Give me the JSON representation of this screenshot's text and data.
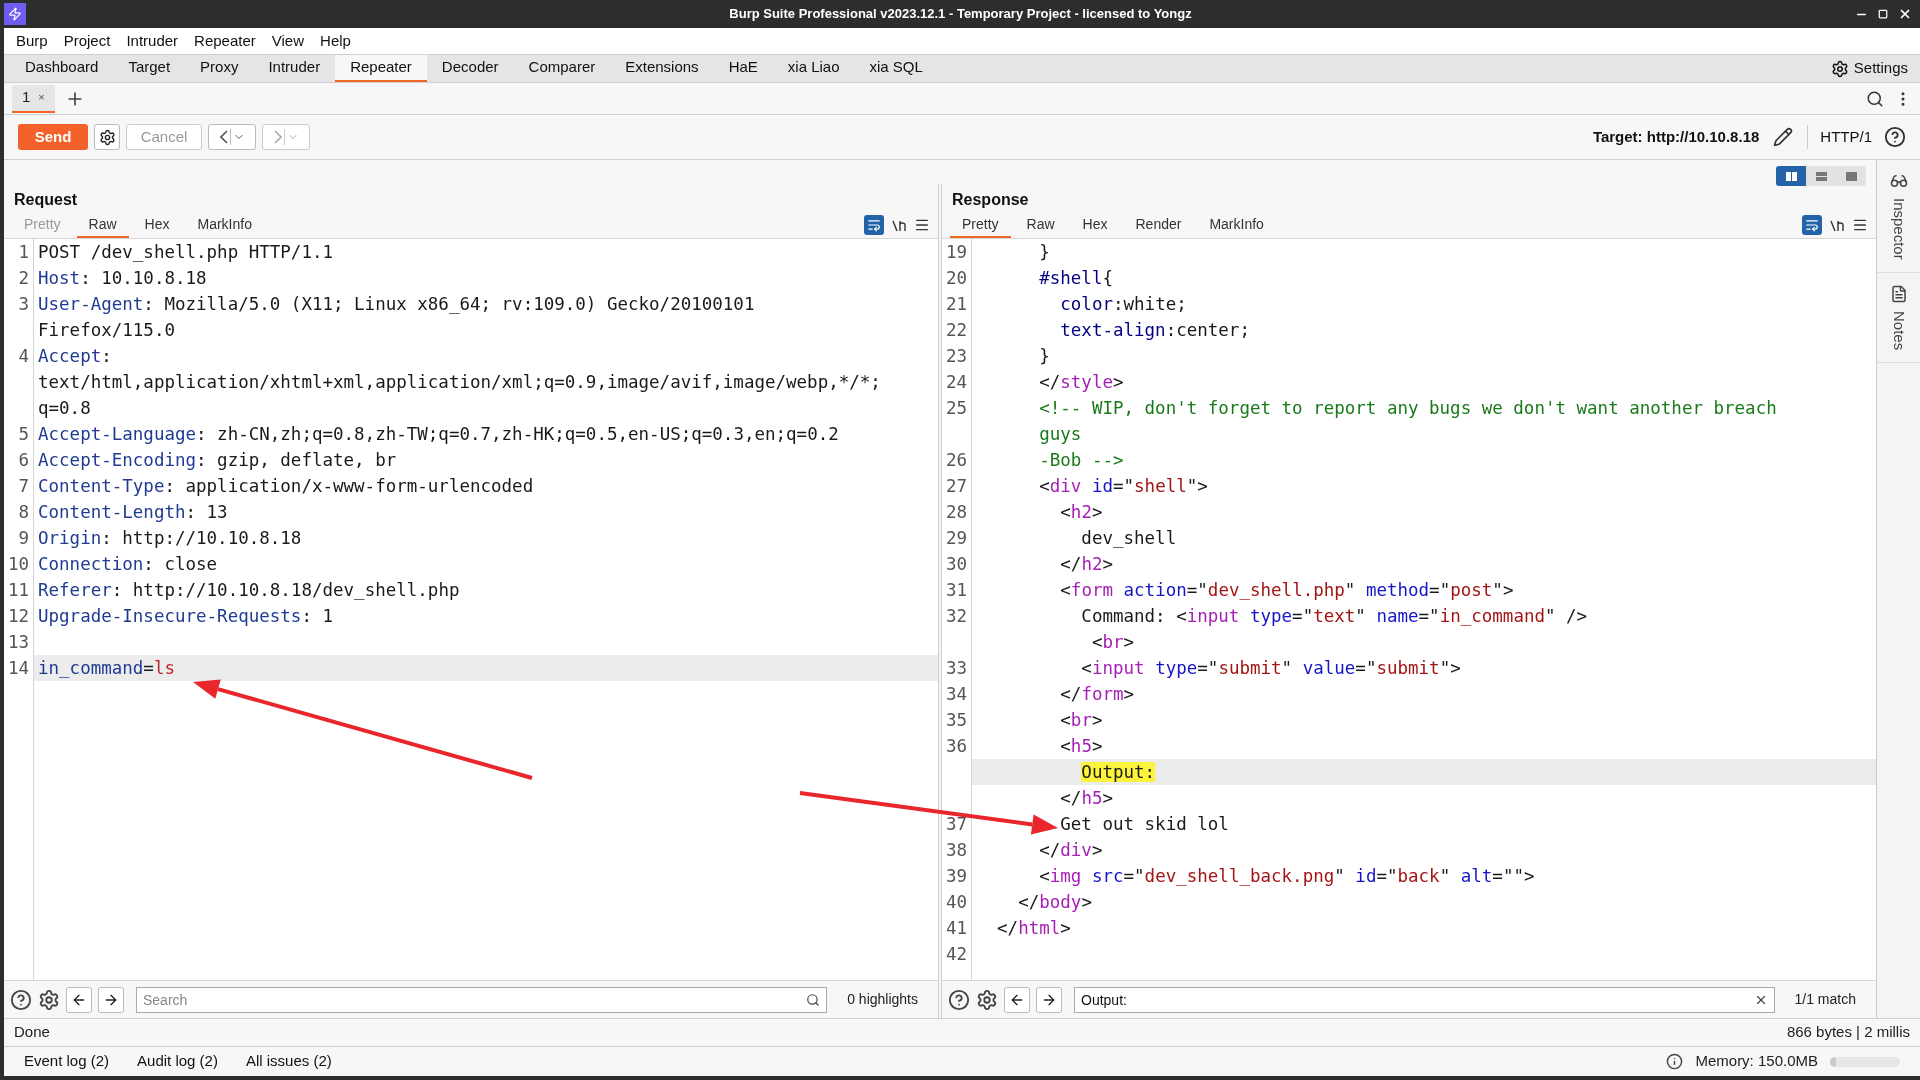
{
  "window": {
    "title": "Burp Suite Professional v2023.12.1 - Temporary Project - licensed to Yongz"
  },
  "menu": [
    "Burp",
    "Project",
    "Intruder",
    "Repeater",
    "View",
    "Help"
  ],
  "tool_tabs": [
    {
      "label": "Dashboard",
      "selected": false
    },
    {
      "label": "Target",
      "selected": false
    },
    {
      "label": "Proxy",
      "selected": false
    },
    {
      "label": "Intruder",
      "selected": false
    },
    {
      "label": "Repeater",
      "selected": true
    },
    {
      "label": "Decoder",
      "selected": false
    },
    {
      "label": "Comparer",
      "selected": false
    },
    {
      "label": "Extensions",
      "selected": false
    },
    {
      "label": "HaE",
      "selected": false
    },
    {
      "label": "xia Liao",
      "selected": false
    },
    {
      "label": "xia SQL",
      "selected": false
    }
  ],
  "settings": "Settings",
  "repeater_tabs": [
    {
      "label": "1",
      "close": "×",
      "selected": true
    }
  ],
  "toolbar": {
    "send": "Send",
    "cancel": "Cancel",
    "target": "Target: http://10.10.8.18",
    "protocol": "HTTP/1"
  },
  "request": {
    "title": "Request",
    "view_tabs": [
      {
        "label": "Pretty",
        "selected": false,
        "disabled": true
      },
      {
        "label": "Raw",
        "selected": true,
        "disabled": false
      },
      {
        "label": "Hex",
        "selected": false,
        "disabled": false
      },
      {
        "label": "MarkInfo",
        "selected": false,
        "disabled": false
      }
    ],
    "lines": [
      {
        "number": "1",
        "rows": [
          {
            "current": false,
            "segments": [
              {
                "kind": "plain",
                "text": "POST /dev_shell.php HTTP/1.1"
              }
            ]
          }
        ]
      },
      {
        "number": "2",
        "rows": [
          {
            "current": false,
            "segments": [
              {
                "kind": "name",
                "text": "Host"
              },
              {
                "kind": "plain",
                "text": ": 10.10.8.18"
              }
            ]
          }
        ]
      },
      {
        "number": "3",
        "rows": [
          {
            "current": false,
            "segments": [
              {
                "kind": "name",
                "text": "User-Agent"
              },
              {
                "kind": "plain",
                "text": ": Mozilla/5.0 (X11; Linux x86_64; rv:109.0) Gecko/20100101"
              }
            ]
          },
          {
            "current": false,
            "segments": [
              {
                "kind": "plain",
                "text": "Firefox/115.0"
              }
            ]
          }
        ]
      },
      {
        "number": "4",
        "rows": [
          {
            "current": false,
            "segments": [
              {
                "kind": "name",
                "text": "Accept"
              },
              {
                "kind": "plain",
                "text": ":"
              }
            ]
          },
          {
            "current": false,
            "segments": [
              {
                "kind": "plain",
                "text": "text/html,application/xhtml+xml,application/xml;q=0.9,image/avif,image/webp,*/*;"
              }
            ]
          },
          {
            "current": false,
            "segments": [
              {
                "kind": "plain",
                "text": "q=0.8"
              }
            ]
          }
        ]
      },
      {
        "number": "5",
        "rows": [
          {
            "current": false,
            "segments": [
              {
                "kind": "name",
                "text": "Accept-Language"
              },
              {
                "kind": "plain",
                "text": ": zh-CN,zh;q=0.8,zh-TW;q=0.7,zh-HK;q=0.5,en-US;q=0.3,en;q=0.2"
              }
            ]
          }
        ]
      },
      {
        "number": "6",
        "rows": [
          {
            "current": false,
            "segments": [
              {
                "kind": "name",
                "text": "Accept-Encoding"
              },
              {
                "kind": "plain",
                "text": ": gzip, deflate, br"
              }
            ]
          }
        ]
      },
      {
        "number": "7",
        "rows": [
          {
            "current": false,
            "segments": [
              {
                "kind": "name",
                "text": "Content-Type"
              },
              {
                "kind": "plain",
                "text": ": application/x-www-form-urlencoded"
              }
            ]
          }
        ]
      },
      {
        "number": "8",
        "rows": [
          {
            "current": false,
            "segments": [
              {
                "kind": "name",
                "text": "Content-Length"
              },
              {
                "kind": "plain",
                "text": ": 13"
              }
            ]
          }
        ]
      },
      {
        "number": "9",
        "rows": [
          {
            "current": false,
            "segments": [
              {
                "kind": "name",
                "text": "Origin"
              },
              {
                "kind": "plain",
                "text": ": http://10.10.8.18"
              }
            ]
          }
        ]
      },
      {
        "number": "10",
        "rows": [
          {
            "current": false,
            "segments": [
              {
                "kind": "name",
                "text": "Connection"
              },
              {
                "kind": "plain",
                "text": ": close"
              }
            ]
          }
        ]
      },
      {
        "number": "11",
        "rows": [
          {
            "current": false,
            "segments": [
              {
                "kind": "name",
                "text": "Referer"
              },
              {
                "kind": "plain",
                "text": ": http://10.10.8.18/dev_shell.php"
              }
            ]
          }
        ]
      },
      {
        "number": "12",
        "rows": [
          {
            "current": false,
            "segments": [
              {
                "kind": "name",
                "text": "Upgrade-Insecure-Requests"
              },
              {
                "kind": "plain",
                "text": ": 1"
              }
            ]
          }
        ]
      },
      {
        "number": "13"
      },
      {
        "number": "14",
        "rows": [
          {
            "current": true,
            "segments": [
              {
                "kind": "name",
                "text": "in_command"
              },
              {
                "kind": "plain",
                "text": "="
              },
              {
                "kind": "value",
                "text": "ls"
              }
            ]
          }
        ]
      }
    ],
    "search": {
      "placeholder": "Search"
    },
    "result": "0 highlights"
  },
  "response": {
    "title": "Response",
    "view_tabs": [
      {
        "label": "Pretty",
        "selected": true,
        "disabled": false
      },
      {
        "label": "Raw",
        "selected": false,
        "disabled": false
      },
      {
        "label": "Hex",
        "selected": false,
        "disabled": false
      },
      {
        "label": "Render",
        "selected": false,
        "disabled": false
      },
      {
        "label": "MarkInfo",
        "selected": false,
        "disabled": false
      }
    ],
    "lines": [
      {
        "number": "19",
        "rows": [
          {
            "current": false,
            "segments": [
              {
                "kind": "plain",
                "text": "      }"
              }
            ]
          }
        ]
      },
      {
        "number": "20",
        "rows": [
          {
            "current": false,
            "segments": [
              {
                "kind": "prop",
                "text": "      #shell"
              },
              {
                "kind": "plain",
                "text": "{"
              }
            ]
          }
        ]
      },
      {
        "number": "21",
        "rows": [
          {
            "current": false,
            "segments": [
              {
                "kind": "prop",
                "text": "        color"
              },
              {
                "kind": "plain",
                "text": ":white;"
              }
            ]
          }
        ]
      },
      {
        "number": "22",
        "rows": [
          {
            "current": false,
            "segments": [
              {
                "kind": "prop",
                "text": "        text-align"
              },
              {
                "kind": "plain",
                "text": ":center;"
              }
            ]
          }
        ]
      },
      {
        "number": "23",
        "rows": [
          {
            "current": false,
            "segments": [
              {
                "kind": "plain",
                "text": "      }"
              }
            ]
          }
        ]
      },
      {
        "number": "24",
        "rows": [
          {
            "current": false,
            "segments": [
              {
                "kind": "plain",
                "text": "      </"
              },
              {
                "kind": "tag",
                "text": "style"
              },
              {
                "kind": "plain",
                "text": ">"
              }
            ]
          }
        ]
      },
      {
        "number": "25",
        "rows": [
          {
            "current": false,
            "segments": [
              {
                "kind": "comment",
                "text": "      <!-- WIP, don't forget to report any bugs we don't want another breach"
              }
            ]
          },
          {
            "current": false,
            "segments": [
              {
                "kind": "comment",
                "text": "      guys"
              }
            ]
          }
        ]
      },
      {
        "number": "26",
        "rows": [
          {
            "current": false,
            "segments": [
              {
                "kind": "comment",
                "text": "      -Bob -->"
              }
            ]
          }
        ]
      },
      {
        "number": "27",
        "rows": [
          {
            "current": false,
            "segments": [
              {
                "kind": "plain",
                "text": "      <"
              },
              {
                "kind": "tag",
                "text": "div"
              },
              {
                "kind": "attr",
                "text": " id"
              },
              {
                "kind": "plain",
                "text": "=\""
              },
              {
                "kind": "string",
                "text": "shell"
              },
              {
                "kind": "plain",
                "text": "\">"
              }
            ]
          }
        ]
      },
      {
        "number": "28",
        "rows": [
          {
            "current": false,
            "segments": [
              {
                "kind": "plain",
                "text": "        <"
              },
              {
                "kind": "tag",
                "text": "h2"
              },
              {
                "kind": "plain",
                "text": ">"
              }
            ]
          }
        ]
      },
      {
        "number": "29",
        "rows": [
          {
            "current": false,
            "segments": [
              {
                "kind": "plain",
                "text": "          dev_shell"
              }
            ]
          }
        ]
      },
      {
        "number": "30",
        "rows": [
          {
            "current": false,
            "segments": [
              {
                "kind": "plain",
                "text": "        </"
              },
              {
                "kind": "tag",
                "text": "h2"
              },
              {
                "kind": "plain",
                "text": ">"
              }
            ]
          }
        ]
      },
      {
        "number": "31",
        "rows": [
          {
            "current": false,
            "segments": [
              {
                "kind": "plain",
                "text": "        <"
              },
              {
                "kind": "tag",
                "text": "form"
              },
              {
                "kind": "attr",
                "text": " action"
              },
              {
                "kind": "plain",
                "text": "=\""
              },
              {
                "kind": "string",
                "text": "dev_shell.php"
              },
              {
                "kind": "plain",
                "text": "\" "
              },
              {
                "kind": "attr",
                "text": "method"
              },
              {
                "kind": "plain",
                "text": "=\""
              },
              {
                "kind": "string",
                "text": "post"
              },
              {
                "kind": "plain",
                "text": "\">"
              }
            ]
          }
        ]
      },
      {
        "number": "32",
        "rows": [
          {
            "current": false,
            "segments": [
              {
                "kind": "plain",
                "text": "          Command: <"
              },
              {
                "kind": "tag",
                "text": "input"
              },
              {
                "kind": "attr",
                "text": " type"
              },
              {
                "kind": "plain",
                "text": "=\""
              },
              {
                "kind": "string",
                "text": "text"
              },
              {
                "kind": "plain",
                "text": "\" "
              },
              {
                "kind": "attr",
                "text": "name"
              },
              {
                "kind": "plain",
                "text": "=\""
              },
              {
                "kind": "string",
                "text": "in_command"
              },
              {
                "kind": "plain",
                "text": "\" />"
              }
            ]
          },
          {
            "current": false,
            "segments": [
              {
                "kind": "plain",
                "text": "           <"
              },
              {
                "kind": "tag",
                "text": "br"
              },
              {
                "kind": "plain",
                "text": ">"
              }
            ]
          }
        ]
      },
      {
        "number": "33",
        "rows": [
          {
            "current": false,
            "segments": [
              {
                "kind": "plain",
                "text": "          <"
              },
              {
                "kind": "tag",
                "text": "input"
              },
              {
                "kind": "attr",
                "text": " type"
              },
              {
                "kind": "plain",
                "text": "=\""
              },
              {
                "kind": "string",
                "text": "submit"
              },
              {
                "kind": "plain",
                "text": "\" "
              },
              {
                "kind": "attr",
                "text": "value"
              },
              {
                "kind": "plain",
                "text": "=\""
              },
              {
                "kind": "string",
                "text": "submit"
              },
              {
                "kind": "plain",
                "text": "\">"
              }
            ]
          }
        ]
      },
      {
        "number": "34",
        "rows": [
          {
            "current": false,
            "segments": [
              {
                "kind": "plain",
                "text": "        </"
              },
              {
                "kind": "tag",
                "text": "form"
              },
              {
                "kind": "plain",
                "text": ">"
              }
            ]
          }
        ]
      },
      {
        "number": "35",
        "rows": [
          {
            "current": false,
            "segments": [
              {
                "kind": "plain",
                "text": "        <"
              },
              {
                "kind": "tag",
                "text": "br"
              },
              {
                "kind": "plain",
                "text": ">"
              }
            ]
          }
        ]
      },
      {
        "number": "36",
        "rows": [
          {
            "current": false,
            "segments": [
              {
                "kind": "plain",
                "text": "        <"
              },
              {
                "kind": "tag",
                "text": "h5"
              },
              {
                "kind": "plain",
                "text": ">"
              }
            ]
          },
          {
            "current": true,
            "segments": [
              {
                "kind": "match",
                "text": "          Output:"
              }
            ]
          },
          {
            "current": false,
            "segments": [
              {
                "kind": "plain",
                "text": "        </"
              },
              {
                "kind": "tag",
                "text": "h5"
              },
              {
                "kind": "plain",
                "text": ">"
              }
            ]
          }
        ]
      },
      {
        "number": "37",
        "rows": [
          {
            "current": false,
            "segments": [
              {
                "kind": "plain",
                "text": "        Get out skid lol"
              }
            ]
          }
        ]
      },
      {
        "number": "38",
        "rows": [
          {
            "current": false,
            "segments": [
              {
                "kind": "plain",
                "text": "      </"
              },
              {
                "kind": "tag",
                "text": "div"
              },
              {
                "kind": "plain",
                "text": ">"
              }
            ]
          }
        ]
      },
      {
        "number": "39",
        "rows": [
          {
            "current": false,
            "segments": [
              {
                "kind": "plain",
                "text": "      <"
              },
              {
                "kind": "tag",
                "text": "img"
              },
              {
                "kind": "attr",
                "text": " src"
              },
              {
                "kind": "plain",
                "text": "=\""
              },
              {
                "kind": "string",
                "text": "dev_shell_back.png"
              },
              {
                "kind": "plain",
                "text": "\" "
              },
              {
                "kind": "attr",
                "text": "id"
              },
              {
                "kind": "plain",
                "text": "=\""
              },
              {
                "kind": "string",
                "text": "back"
              },
              {
                "kind": "plain",
                "text": "\" "
              },
              {
                "kind": "attr",
                "text": "alt"
              },
              {
                "kind": "plain",
                "text": "=\"\">"
              }
            ]
          }
        ]
      },
      {
        "number": "40",
        "rows": [
          {
            "current": false,
            "segments": [
              {
                "kind": "plain",
                "text": "    </"
              },
              {
                "kind": "tag",
                "text": "body"
              },
              {
                "kind": "plain",
                "text": ">"
              }
            ]
          }
        ]
      },
      {
        "number": "41",
        "rows": [
          {
            "current": false,
            "segments": [
              {
                "kind": "plain",
                "text": "  </"
              },
              {
                "kind": "tag",
                "text": "html"
              },
              {
                "kind": "plain",
                "text": ">"
              }
            ]
          }
        ]
      },
      {
        "number": "42"
      }
    ],
    "search": {
      "value": "Output:"
    },
    "result": "1/1 match"
  },
  "side_panel": [
    "Inspector",
    "Notes"
  ],
  "status": {
    "left": "Done",
    "right": "866 bytes | 2 millis"
  },
  "bottom_tabs": [
    "Event log (2)",
    "Audit log (2)",
    "All issues (2)"
  ],
  "memory": {
    "label": "Memory: 150.0MB",
    "level": 0.08
  }
}
